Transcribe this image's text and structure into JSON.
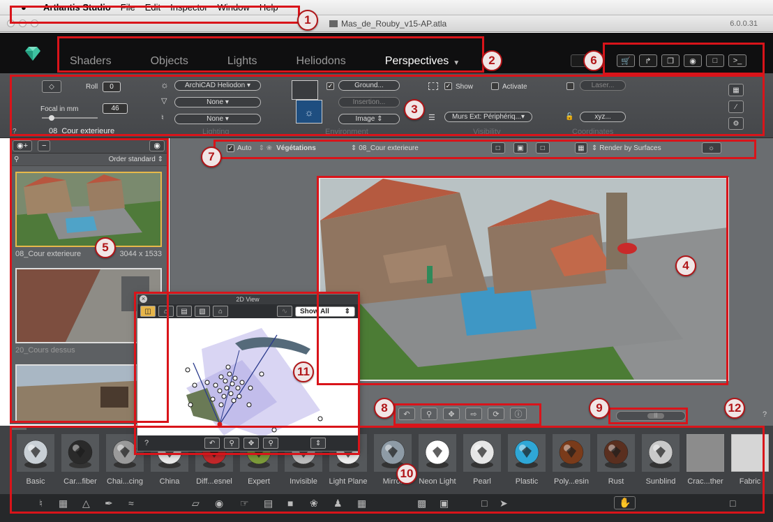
{
  "menubar": {
    "app_name": "Artlantis Studio",
    "items": [
      "File",
      "Edit",
      "Inspector",
      "Window",
      "Help"
    ]
  },
  "window": {
    "title": "Mas_de_Rouby_v15-AP.atla",
    "version": "6.0.0.31"
  },
  "tabs": [
    {
      "label": "Shaders",
      "active": false
    },
    {
      "label": "Objects",
      "active": false
    },
    {
      "label": "Lights",
      "active": false
    },
    {
      "label": "Heliodons",
      "active": false
    },
    {
      "label": "Perspectives",
      "active": true
    }
  ],
  "toolbar_icons": [
    "cart-icon",
    "axis-icon",
    "windows-icon",
    "camera-icon",
    "crop-icon",
    "terminal-icon"
  ],
  "inspector": {
    "roll_label": "Roll",
    "roll_value": "0",
    "focal_label": "Focal in mm",
    "focal_value": "46",
    "help": "?",
    "view_name": "08_Cour exterieure",
    "lighting": {
      "heliodon": "ArchiCAD Heliodon",
      "light_group": "None",
      "light_set": "None",
      "section": "Lighting"
    },
    "environment": {
      "ground": "Ground...",
      "insertion": "Insertion...",
      "background": "Image",
      "section": "Environment"
    },
    "visibility": {
      "show_label": "Show",
      "activate_label": "Activate",
      "layer": "Murs Ext: Périphériq...",
      "section": "Visibility"
    },
    "coordinates": {
      "laser": "Laser...",
      "xyz": "xyz...",
      "section": "Coordinates"
    }
  },
  "left_panel": {
    "order": "Order standard",
    "views": [
      {
        "name": "08_Cour exterieure",
        "size": "3044 x 1533",
        "selected": true
      },
      {
        "name": "20_Cours dessus",
        "size": "3044",
        "selected": false
      },
      {
        "name": "",
        "size": "",
        "selected": false
      }
    ]
  },
  "view_toolbar": {
    "auto_label": "Auto",
    "vegetation": "Végétations",
    "view": "08_Cour exterieure",
    "render_mode": "Render by Surfaces"
  },
  "view2d": {
    "title": "2D View",
    "filter": "Show All",
    "help": "?"
  },
  "shaders": [
    {
      "name": "Basic",
      "color": "#c9d0d6"
    },
    {
      "name": "Car...fiber",
      "color": "#2a2a2a"
    },
    {
      "name": "Chai...cing",
      "color": "#9a9a9a"
    },
    {
      "name": "China",
      "color": "#e9e9e9"
    },
    {
      "name": "Diff...esnel",
      "color": "#c2282a"
    },
    {
      "name": "Expert",
      "color": "#7c9a3a"
    },
    {
      "name": "Invisible",
      "color": "#bcbcbc"
    },
    {
      "name": "Light Plane",
      "color": "#eeeeee"
    },
    {
      "name": "Mirror",
      "color": "#8e9ba6"
    },
    {
      "name": "Neon Light",
      "color": "#ffffff"
    },
    {
      "name": "Pearl",
      "color": "#e6e6e6"
    },
    {
      "name": "Plastic",
      "color": "#2fa7d6"
    },
    {
      "name": "Poly...esin",
      "color": "#7a3b1a"
    },
    {
      "name": "Rust",
      "color": "#5a2f1f"
    },
    {
      "name": "Sunblind",
      "color": "#c9c9c9"
    },
    {
      "name": "Crac...ther",
      "color": "#8c8c8c"
    },
    {
      "name": "Fabric",
      "color": "#d6d6d6"
    }
  ],
  "annotations": [
    "1",
    "2",
    "3",
    "4",
    "5",
    "6",
    "7",
    "8",
    "9",
    "10",
    "11",
    "12"
  ],
  "colors": {
    "annotation": "#d9141a",
    "selection": "#e7b94a",
    "accent_gem": "#3ec3a1"
  }
}
